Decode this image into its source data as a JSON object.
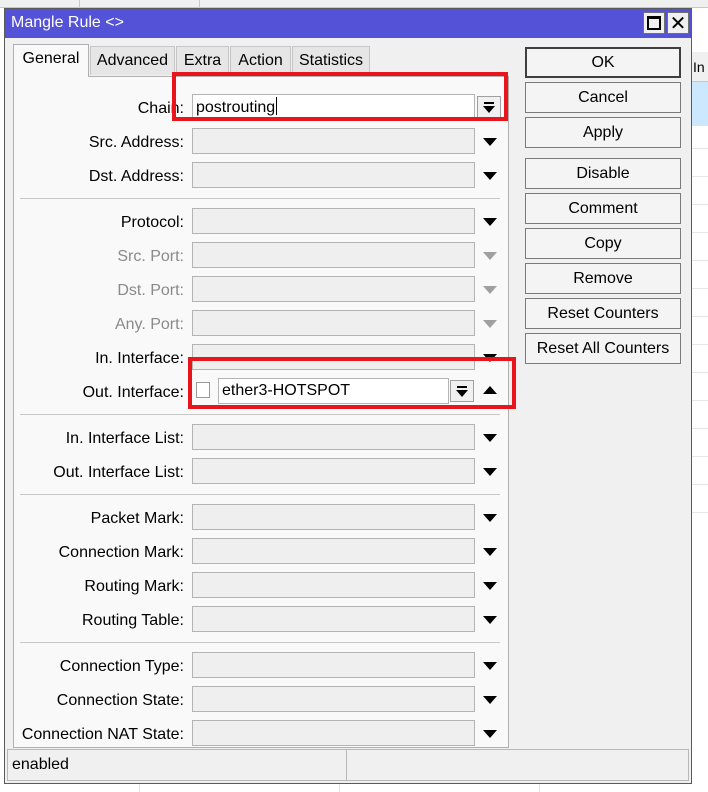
{
  "background_window": {
    "right_column_header": "In"
  },
  "dialog": {
    "title": "Mangle Rule <>",
    "tabs": [
      {
        "label": "General",
        "active": true
      },
      {
        "label": "Advanced",
        "active": false
      },
      {
        "label": "Extra",
        "active": false
      },
      {
        "label": "Action",
        "active": false
      },
      {
        "label": "Statistics",
        "active": false
      }
    ],
    "fields": {
      "chain": {
        "label": "Chain:",
        "value": "postrouting"
      },
      "src_address": {
        "label": "Src. Address:",
        "value": ""
      },
      "dst_address": {
        "label": "Dst. Address:",
        "value": ""
      },
      "protocol": {
        "label": "Protocol:",
        "value": ""
      },
      "src_port": {
        "label": "Src. Port:",
        "value": ""
      },
      "dst_port": {
        "label": "Dst. Port:",
        "value": ""
      },
      "any_port": {
        "label": "Any. Port:",
        "value": ""
      },
      "in_interface": {
        "label": "In. Interface:",
        "value": ""
      },
      "out_interface": {
        "label": "Out. Interface:",
        "value": "ether3-HOTSPOT",
        "negate_checked": false
      },
      "in_interface_list": {
        "label": "In. Interface List:",
        "value": ""
      },
      "out_interface_list": {
        "label": "Out. Interface List:",
        "value": ""
      },
      "packet_mark": {
        "label": "Packet Mark:",
        "value": ""
      },
      "connection_mark": {
        "label": "Connection Mark:",
        "value": ""
      },
      "routing_mark": {
        "label": "Routing Mark:",
        "value": ""
      },
      "routing_table": {
        "label": "Routing Table:",
        "value": ""
      },
      "connection_type": {
        "label": "Connection Type:",
        "value": ""
      },
      "connection_state": {
        "label": "Connection State:",
        "value": ""
      },
      "connection_nat_state": {
        "label": "Connection NAT State:",
        "value": ""
      }
    },
    "buttons": {
      "ok": "OK",
      "cancel": "Cancel",
      "apply": "Apply",
      "disable": "Disable",
      "comment": "Comment",
      "copy": "Copy",
      "remove": "Remove",
      "reset_counters": "Reset Counters",
      "reset_all_counters": "Reset All Counters"
    },
    "status": {
      "state": "enabled",
      "extra": ""
    }
  },
  "colors": {
    "titlebar": "#5452d6",
    "highlight": "#e8161c",
    "selection_row": "#cce8ff"
  },
  "icons": [
    "maximize-icon",
    "close-icon",
    "dropdown-arrow-icon",
    "expand-up-icon"
  ]
}
